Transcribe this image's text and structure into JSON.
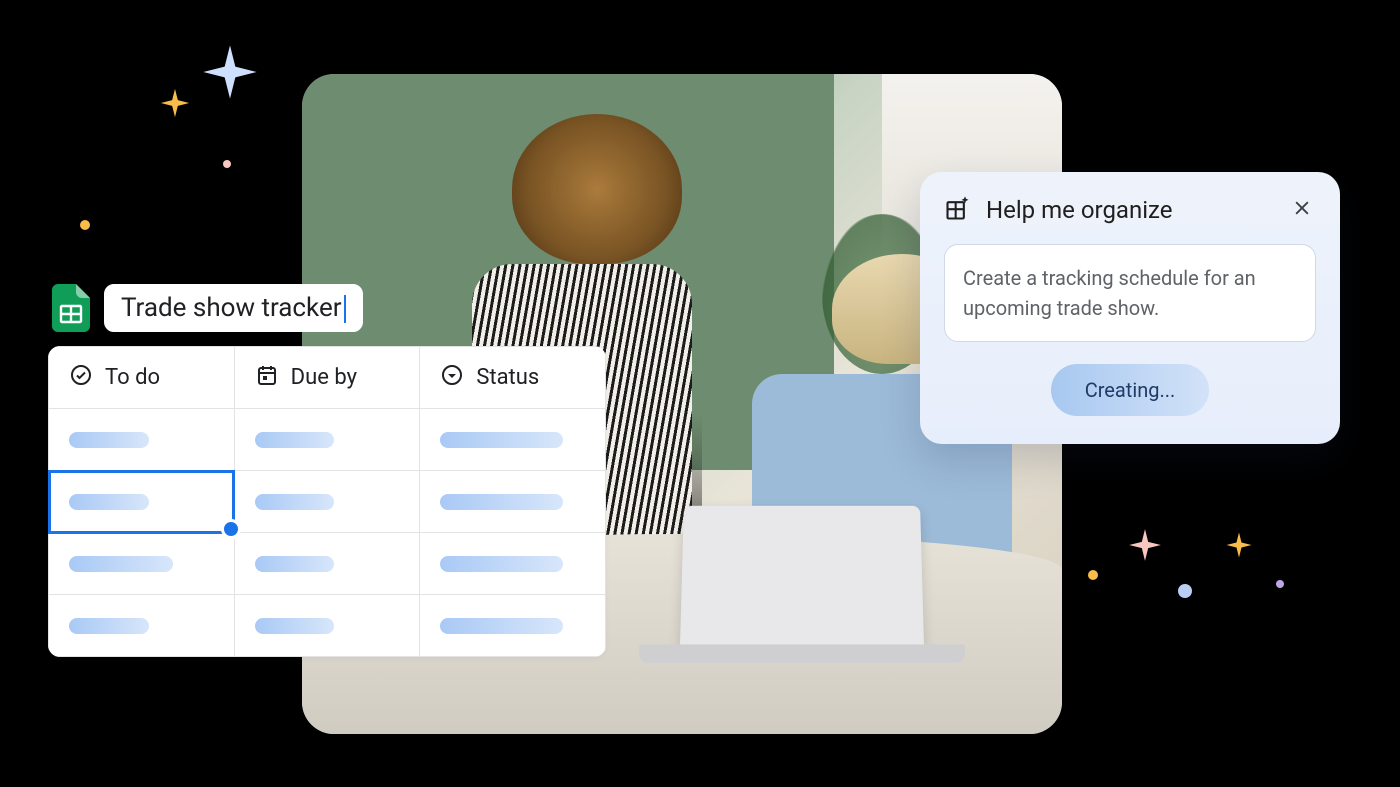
{
  "spreadsheet": {
    "doc_title": "Trade show tracker",
    "columns": [
      {
        "label": "To do",
        "icon": "check-circle-icon"
      },
      {
        "label": "Due by",
        "icon": "calendar-icon"
      },
      {
        "label": "Status",
        "icon": "dropdown-circle-icon"
      }
    ],
    "row_count": 4,
    "selected_cell": {
      "row": 1,
      "col": 0
    }
  },
  "organize_panel": {
    "title": "Help me organize",
    "prompt_text": "Create a tracking schedule for an upcoming trade show.",
    "action_label": "Creating..."
  },
  "decor": {
    "sparkles": true
  }
}
